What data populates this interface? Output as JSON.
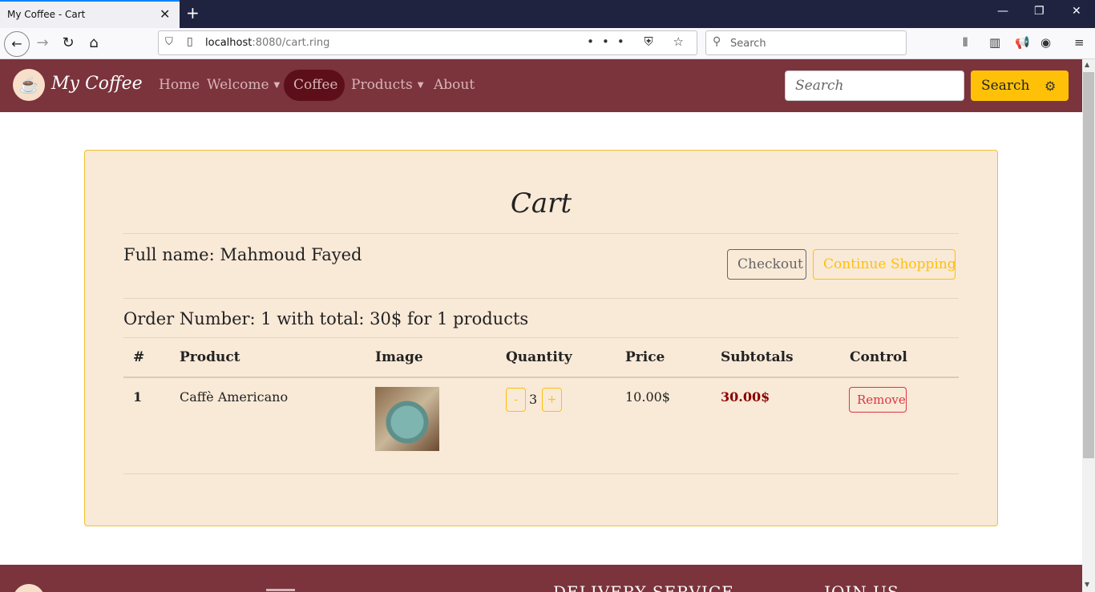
{
  "browser": {
    "tab_title": "My Coffee - Cart",
    "url_host": "localhost",
    "url_rest": ":8080/cart.ring",
    "search_placeholder": "Search"
  },
  "site": {
    "brand": "My Coffee",
    "nav": {
      "home": "Home",
      "welcome": "Welcome",
      "coffee": "Coffee",
      "products": "Products",
      "about": "About"
    },
    "search_placeholder": "Search",
    "search_button": "Search"
  },
  "cart": {
    "title": "Cart",
    "full_name": "Full name: Mahmoud Fayed",
    "checkout_label": "Checkout",
    "continue_label": "Continue Shopping",
    "order_summary": "Order Number: 1 with total: 30$ for 1 products",
    "columns": [
      "#",
      "Product",
      "Image",
      "Quantity",
      "Price",
      "Subtotals",
      "Control"
    ],
    "rows": [
      {
        "num": "1",
        "product": "Caffè Americano",
        "quantity": "3",
        "minus": "-",
        "plus": "+",
        "price": "10.00$",
        "subtotal": "30.00$",
        "remove": "Remove"
      }
    ]
  },
  "footer": {
    "delivery_heading": "DELIVERY SERVICE",
    "join_heading": "JOIN US"
  },
  "colors": {
    "brand_bar": "#7b333c",
    "card_bg": "#f9e9d7",
    "accent_yellow": "#ffc107",
    "danger": "#dc3545"
  }
}
